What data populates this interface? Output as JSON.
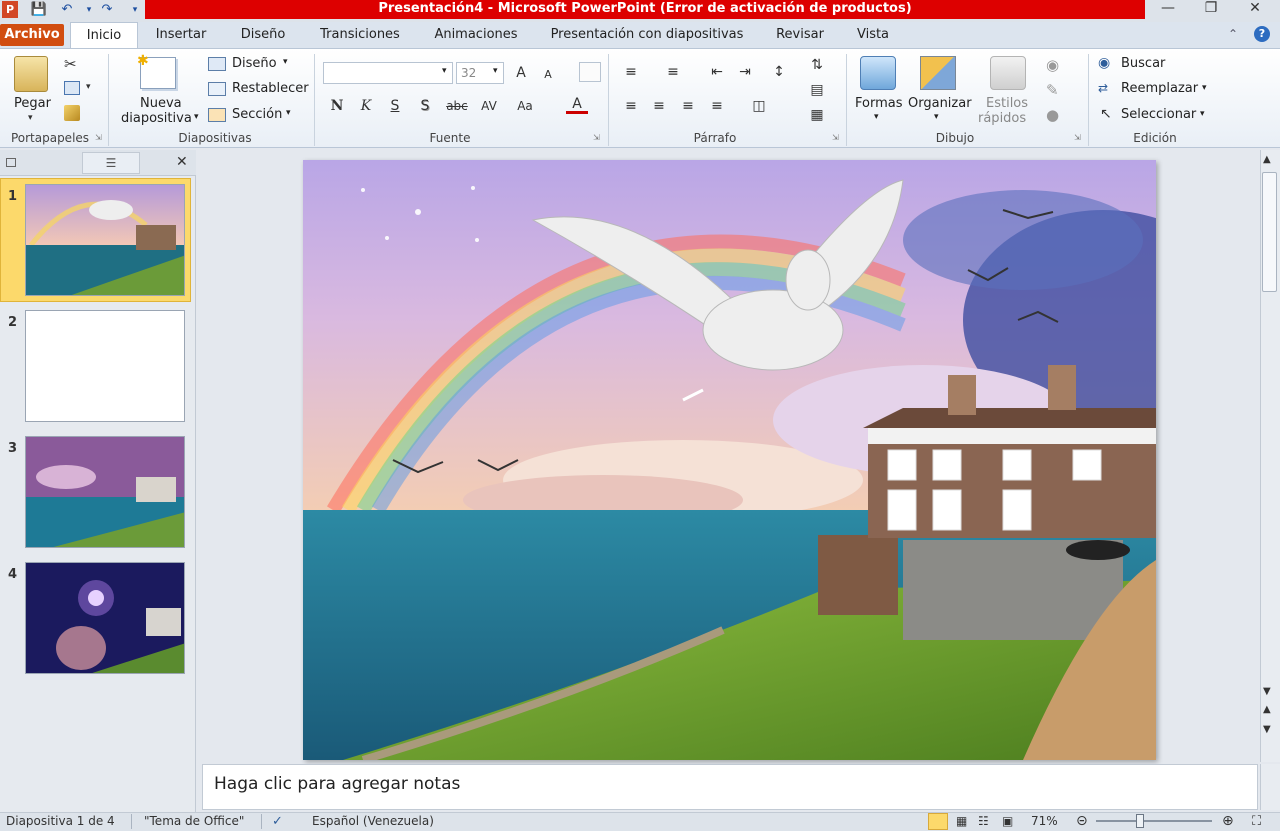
{
  "window": {
    "title": "Presentación4  -  Microsoft PowerPoint (Error de activación de productos)",
    "title_bar_color": "#dd0000"
  },
  "tabs": [
    {
      "label": "Archivo"
    },
    {
      "label": "Inicio"
    },
    {
      "label": "Insertar"
    },
    {
      "label": "Diseño"
    },
    {
      "label": "Transiciones"
    },
    {
      "label": "Animaciones"
    },
    {
      "label": "Presentación con diapositivas"
    },
    {
      "label": "Revisar"
    },
    {
      "label": "Vista"
    }
  ],
  "ribbon": {
    "portapapeles": {
      "pegar": "Pegar",
      "group": "Portapapeles"
    },
    "diapositivas": {
      "nueva_1": "Nueva",
      "nueva_2": "diapositiva",
      "diseno": "Diseño",
      "restablecer": "Restablecer",
      "seccion": "Sección",
      "group": "Diapositivas"
    },
    "fuente": {
      "font_size": "32",
      "group": "Fuente",
      "bold": "N",
      "italic": "K",
      "underline": "S",
      "shadow": "S",
      "strike": "abc",
      "spacing": "AV",
      "case": "Aa",
      "grow": "A",
      "shrink": "A",
      "color": "A"
    },
    "parrafo": {
      "group": "Párrafo"
    },
    "dibujo": {
      "formas": "Formas",
      "organizar": "Organizar",
      "estilos_1": "Estilos",
      "estilos_2": "rápidos",
      "group": "Dibujo"
    },
    "edicion": {
      "buscar": "Buscar",
      "reemplazar": "Reemplazar",
      "seleccionar": "Seleccionar",
      "group": "Edición"
    }
  },
  "thumbnails": [
    {
      "num": "1"
    },
    {
      "num": "2"
    },
    {
      "num": "3"
    },
    {
      "num": "4"
    }
  ],
  "notes": {
    "placeholder": "Haga clic para agregar notas"
  },
  "status": {
    "slide": "Diapositiva 1 de 4",
    "theme": "\"Tema de Office\"",
    "language": "Español (Venezuela)",
    "zoom": "71%"
  },
  "colors": {
    "file_tab": "#d14d10",
    "selected_thumb": "#fcd96b"
  }
}
